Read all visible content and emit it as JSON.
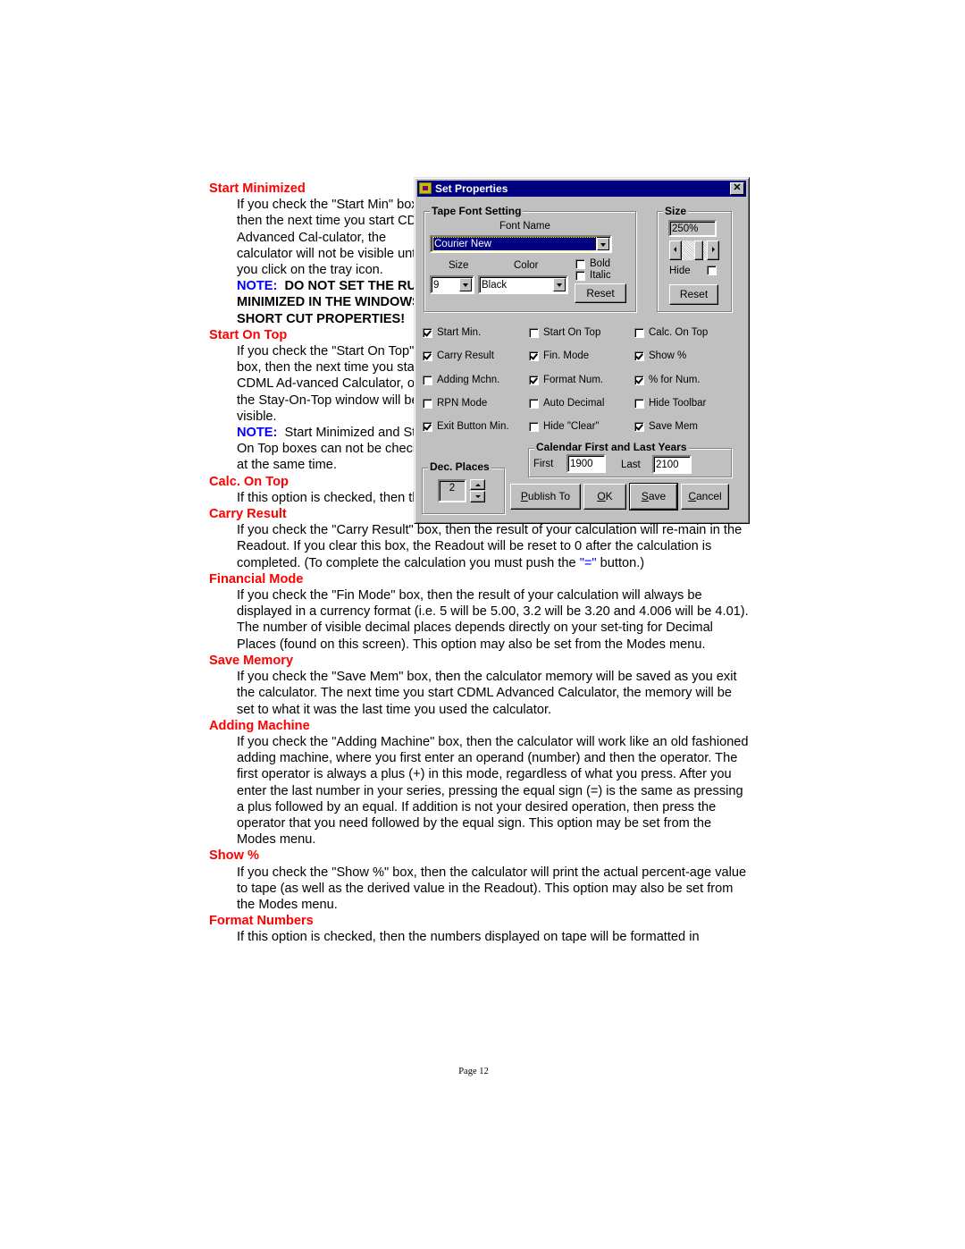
{
  "document": {
    "sections": [
      {
        "heading": "Start Minimized",
        "body": "If you check the \"Start Min\" box, then the next time you start CDML Advanced Cal-culator, the calculator will not be visible until you click on the tray icon.",
        "note_label": "NOTE:",
        "note_text": "DO NOT SET THE RUN MINIMIZED IN THE WINDOWS SHORT CUT PROPERTIES!"
      },
      {
        "heading": "Start On Top",
        "body": "If you check the \"Start On Top\" box, then the next time you start CDML Ad-vanced Calculator, only the Stay-On-Top window will be visible.",
        "note_label": "NOTE:",
        "note_text": "Start Minimized and Start On Top boxes can not be checked at the same time."
      },
      {
        "heading": "Calc. On Top",
        "body": "If this option is checked, then the main calculator screen will remain Topmost."
      },
      {
        "heading": "Carry Result",
        "body": "If you check the \"Carry Result\" box, then the result of your calculation will re-main in the Readout.  If you clear this box, the Readout will be reset to 0 after the calculation is completed.  (To complete the calculation you must push the",
        "highlight": "\"=\"",
        "body_end": "button.)"
      },
      {
        "heading": "Financial Mode",
        "body": "If you check the \"Fin Mode\" box, then the result of your calculation will always be displayed in a currency format (i.e. 5 will be 5.00, 3.2 will be 3.20 and 4.006 will be 4.01). The number of visible decimal places depends directly on your set-ting for Decimal Places (found on this screen).  This option may also be set from the Modes menu."
      },
      {
        "heading": "Save Memory",
        "body": "If you check the \"Save Mem\" box, then the calculator memory will be saved as you exit the calculator.  The next time you start CDML Advanced Calculator, the memory will be set to what it was the last time you used the calculator."
      },
      {
        "heading": "Adding Machine",
        "body": "If you check the \"Adding Machine\" box, then the calculator will work like an old fashioned adding machine, where you first enter an operand (number) and then the operator.  The first operator is always a plus (+) in this mode, regardless of what you press.  After you enter the last number in your series, pressing the equal sign (=) is the same as pressing a plus followed by an equal.  If addition is not your desired operation, then press the operator that you need followed by the equal sign.  This option may be set from the Modes menu."
      },
      {
        "heading": "Show %",
        "body": "If you check the \"Show %\" box, then the calculator will print the actual percent-age value to tape (as well as the derived value in the Readout).  This option may also be set from the Modes menu."
      },
      {
        "heading": "Format Numbers",
        "body": "If this option is checked, then the numbers displayed on tape will be formatted in"
      }
    ],
    "page_label": "Page 12"
  },
  "dialog": {
    "title": "Set Properties",
    "close_glyph": "✕",
    "tape_font": {
      "legend": "Tape Font Setting",
      "font_name_label": "Font Name",
      "font_name_value": "Courier New",
      "size_label": "Size",
      "size_value": "9",
      "color_label": "Color",
      "color_value": "Black",
      "bold_label": "Bold",
      "bold_checked": false,
      "italic_label": "Italic",
      "italic_checked": false,
      "reset_label": "Reset"
    },
    "size_group": {
      "legend": "Size",
      "value": "250%",
      "hide_label": "Hide",
      "hide_checked": false,
      "reset_label": "Reset"
    },
    "options": [
      {
        "label": "Start Min.",
        "checked": true
      },
      {
        "label": "Start On Top",
        "checked": false
      },
      {
        "label": "Calc. On Top",
        "checked": false
      },
      {
        "label": "Carry Result",
        "checked": true
      },
      {
        "label": "Fin. Mode",
        "checked": true
      },
      {
        "label": "Show %",
        "checked": true
      },
      {
        "label": "Adding Mchn.",
        "checked": false
      },
      {
        "label": "Format Num.",
        "checked": true
      },
      {
        "label": "% for Num.",
        "checked": true
      },
      {
        "label": "RPN Mode",
        "checked": false
      },
      {
        "label": "Auto Decimal",
        "checked": false
      },
      {
        "label": "Hide Toolbar",
        "checked": false
      },
      {
        "label": "Exit Button Min.",
        "checked": true
      },
      {
        "label": "Hide \"Clear\"",
        "checked": false
      },
      {
        "label": "Save Mem",
        "checked": true
      }
    ],
    "calendar": {
      "legend": "Calendar First and Last Years",
      "first_label": "First",
      "first_value": "1900",
      "last_label": "Last",
      "last_value": "2100"
    },
    "dec_places": {
      "legend": "Dec. Places",
      "value": "2"
    },
    "buttons": {
      "publish_mnemonic": "P",
      "publish_rest": "ublish To",
      "ok_mnemonic": "O",
      "ok_rest": "K",
      "save_mnemonic": "S",
      "save_rest": "ave",
      "cancel_mnemonic": "C",
      "cancel_rest": "ancel"
    }
  }
}
